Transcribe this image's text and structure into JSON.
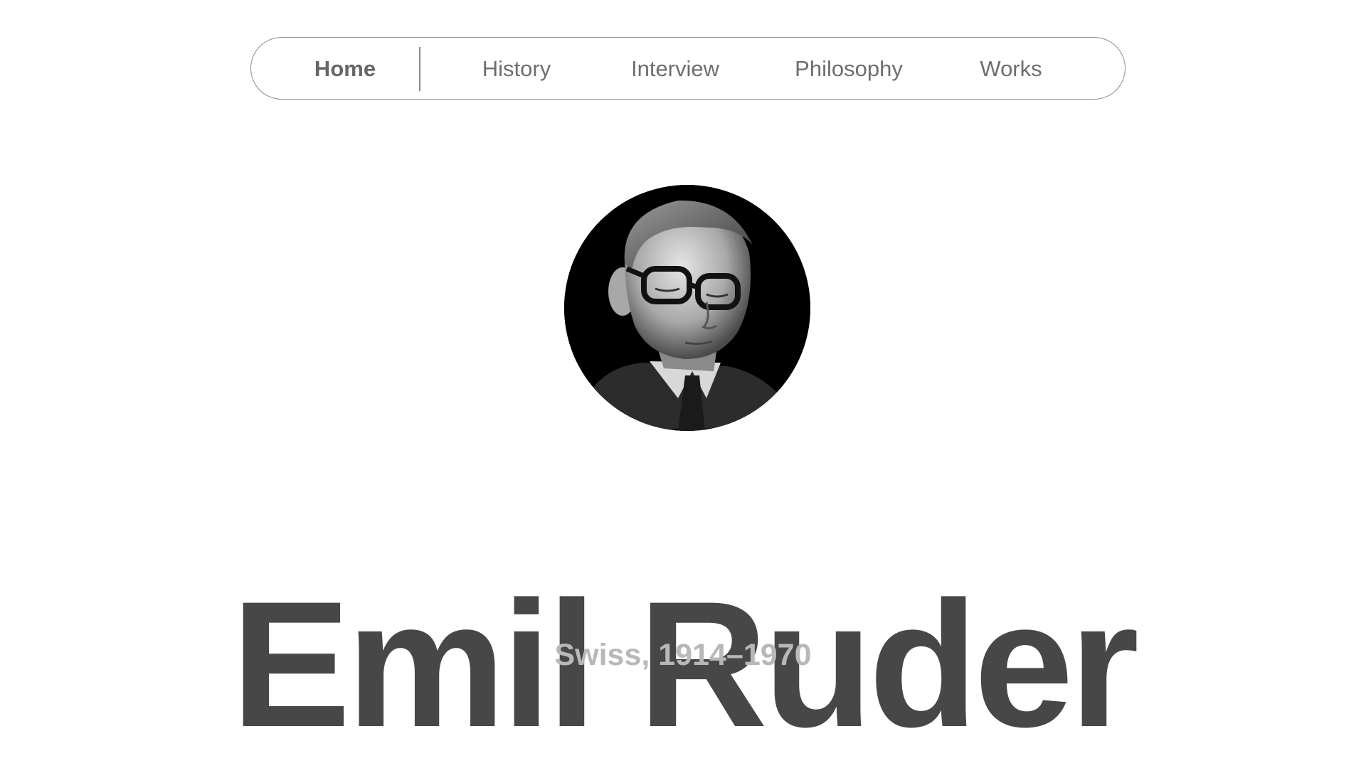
{
  "nav": {
    "items": [
      {
        "label": "Home",
        "active": true
      },
      {
        "label": "History",
        "active": false
      },
      {
        "label": "Interview",
        "active": false
      },
      {
        "label": "Philosophy",
        "active": false
      },
      {
        "label": "Works",
        "active": false
      }
    ]
  },
  "hero": {
    "portrait_icon": "portrait-photo",
    "name": "Emil Ruder",
    "subtitle": "Swiss, 1914–1970"
  },
  "colors": {
    "title": "#474747",
    "subtitle": "#b8b8b8",
    "nav_text": "#6e6e6e",
    "nav_border": "#8a8a8a",
    "background": "#ffffff"
  }
}
